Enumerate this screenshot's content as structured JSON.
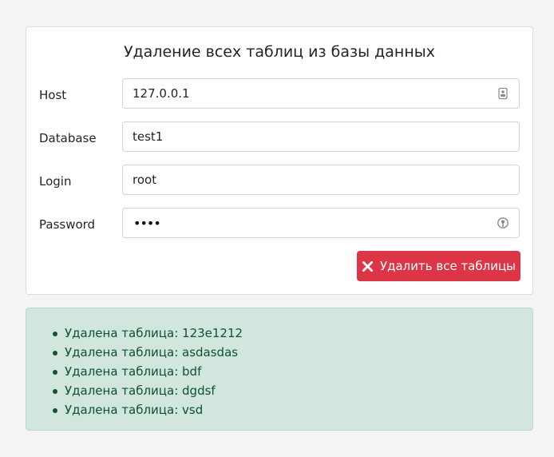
{
  "form": {
    "title": "Удаление всех таблиц из базы данных",
    "host": {
      "label": "Host",
      "value": "127.0.0.1"
    },
    "database": {
      "label": "Database",
      "value": "test1"
    },
    "login": {
      "label": "Login",
      "value": "root"
    },
    "password": {
      "label": "Password",
      "value": "••••"
    },
    "submit_label": "Удалить все таблицы"
  },
  "result": {
    "items": [
      "Удалена таблица: 123e1212",
      "Удалена таблица: asdasdas",
      "Удалена таблица: bdf",
      "Удалена таблица: dgdsf",
      "Удалена таблица: vsd"
    ]
  },
  "colors": {
    "danger": "#dc3545",
    "success_bg": "#d1e7dd",
    "success_text": "#0f5132"
  },
  "icons": {
    "host_field": "contact-card-icon",
    "password_field": "key-autofill-icon",
    "submit": "close-x-icon"
  }
}
